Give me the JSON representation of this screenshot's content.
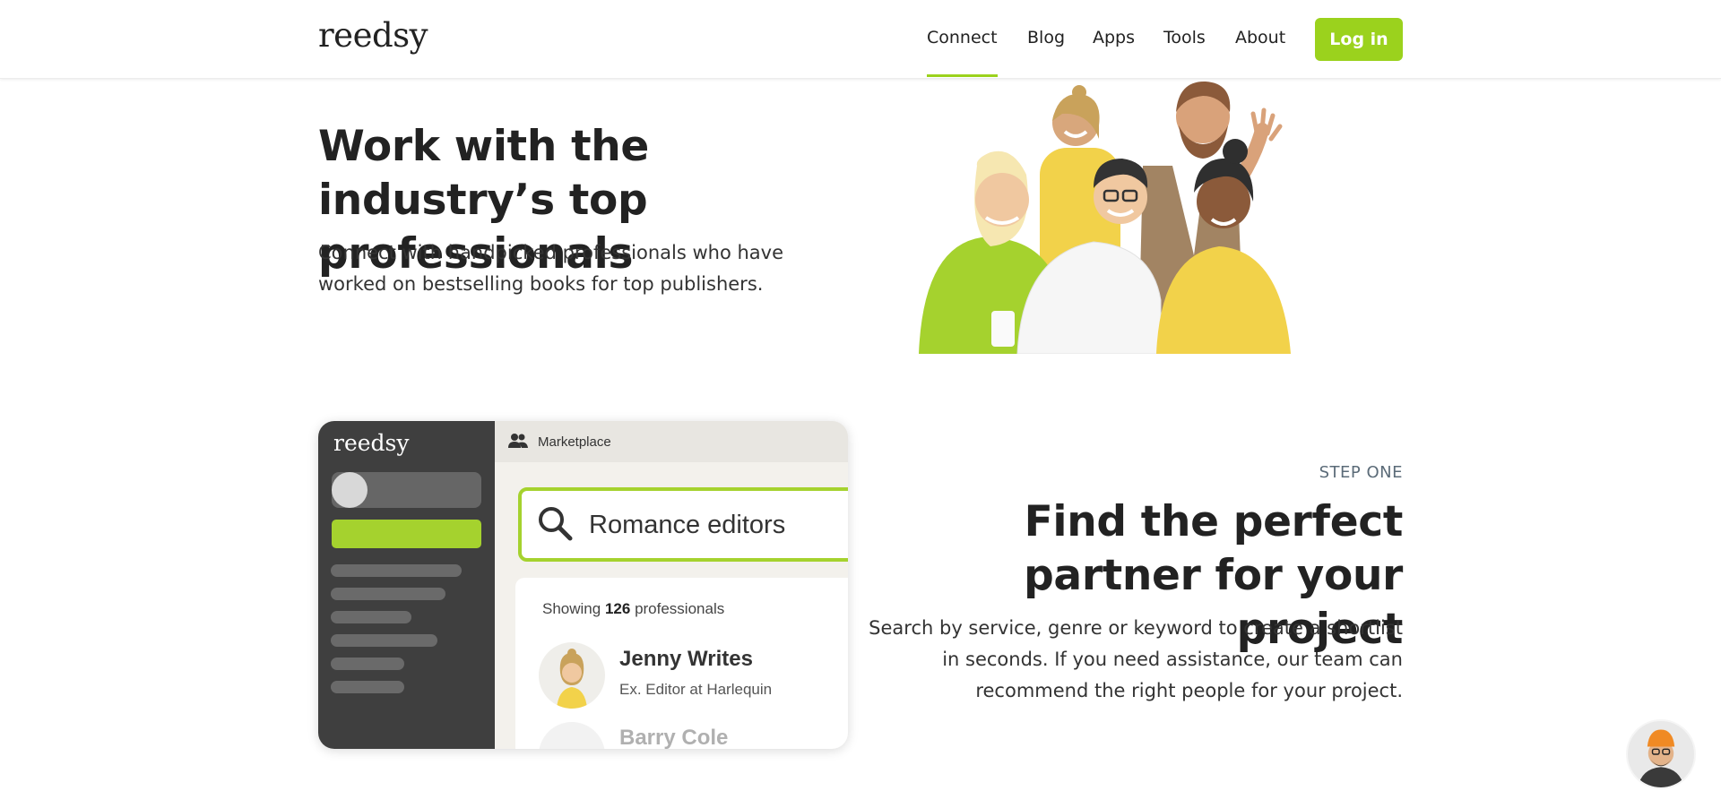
{
  "header": {
    "logo": "reedsy",
    "nav": [
      "Connect",
      "Blog",
      "Apps",
      "Tools",
      "About"
    ],
    "active_nav": "Connect",
    "login": "Log in"
  },
  "hero": {
    "title": "Work with the industry’s top professionals",
    "subtitle": "Connect with handpicked professionals who have worked on bestselling books for top publishers."
  },
  "step": {
    "label": "STEP ONE",
    "title": "Find the perfect partner for your project",
    "body": "Search by service, genre or keyword to create a shortlist in seconds. If you need assistance, our team can recommend the right people for your project."
  },
  "mockup": {
    "logo": "reedsy",
    "tab": "Marketplace",
    "search": "Romance editors",
    "showing_prefix": "Showing",
    "showing_count": "126",
    "showing_suffix": "professionals",
    "result1_name": "Jenny Writes",
    "result1_role": "Ex. Editor at Harlequin",
    "result2_name": "Barry Cole"
  },
  "colors": {
    "accent": "#9bd21d",
    "dark_sidebar": "#3f3f3f",
    "text": "#222222"
  }
}
